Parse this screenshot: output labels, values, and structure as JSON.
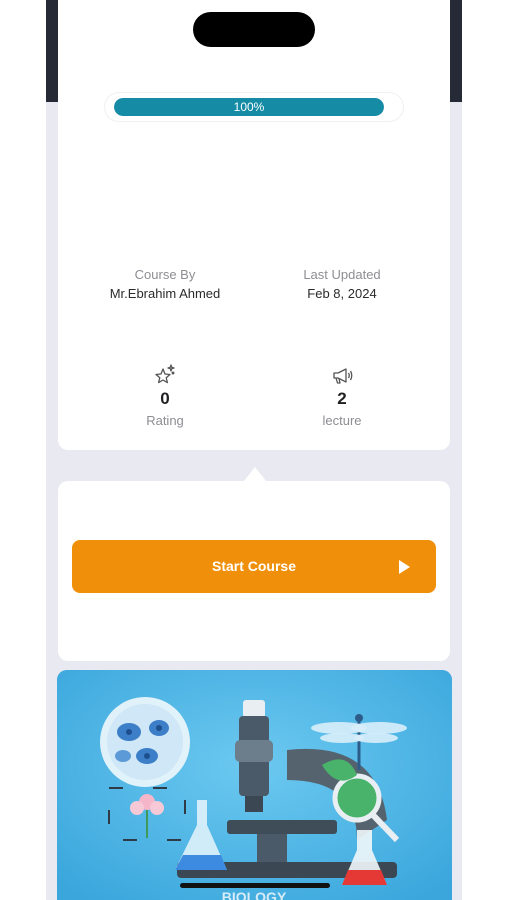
{
  "progress": {
    "value": 1.0,
    "label": "100%"
  },
  "course_meta": {
    "author_label": "Course By",
    "author_value": "Mr.Ebrahim Ahmed",
    "updated_label": "Last Updated",
    "updated_value": "Feb 8, 2024"
  },
  "stats": {
    "rating": {
      "value": "0",
      "label": "Rating",
      "icon": "sparkle-star-icon"
    },
    "lectures": {
      "value": "2",
      "label": "lecture",
      "icon": "megaphone-icon"
    }
  },
  "actions": {
    "start_label": "Start Course",
    "start_icon": "play-icon"
  },
  "image": {
    "caption": "BIOLOGY",
    "description_icons": [
      "microscope-icon",
      "dragonfly-icon",
      "flask-icon",
      "flower-icon",
      "cell-icon"
    ]
  },
  "colors": {
    "accent": "#f0900a",
    "progress": "#168ba6",
    "background": "#e9e9f1"
  }
}
